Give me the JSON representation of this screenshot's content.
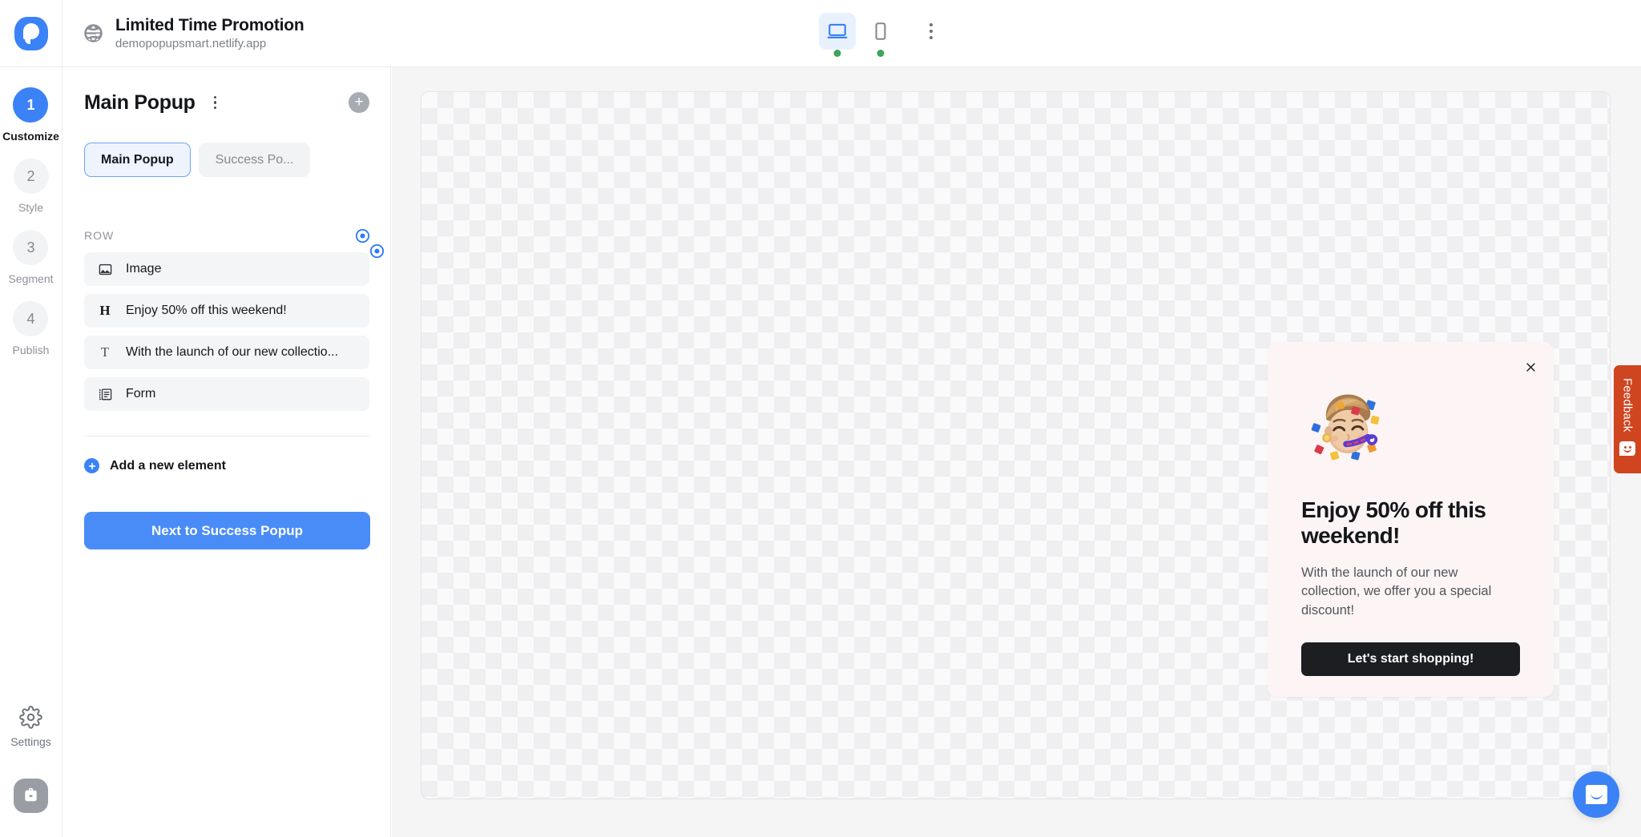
{
  "header": {
    "logo_icon": "popupsmart-logo",
    "site_icon": "globe-icon",
    "site_title": "Limited Time Promotion",
    "site_url": "demopopupsmart.netlify.app",
    "devices": [
      {
        "name": "desktop",
        "icon": "desktop-icon",
        "active": true,
        "status_dot": true
      },
      {
        "name": "mobile",
        "icon": "mobile-icon",
        "active": false,
        "status_dot": true
      }
    ],
    "more_icon": "kebab-menu-icon"
  },
  "rail": {
    "steps": [
      {
        "number": "1",
        "label": "Customize",
        "active": true
      },
      {
        "number": "2",
        "label": "Style",
        "active": false
      },
      {
        "number": "3",
        "label": "Segment",
        "active": false
      },
      {
        "number": "4",
        "label": "Publish",
        "active": false
      }
    ],
    "settings_label": "Settings",
    "settings_icon": "gear-icon",
    "toolbox_icon": "briefcase-icon"
  },
  "panel": {
    "title": "Main Popup",
    "more_icon": "kebab-menu-icon",
    "add_icon": "plus-circle-icon",
    "tabs": [
      {
        "label": "Main Popup",
        "active": true
      },
      {
        "label": "Success Po...",
        "active": false
      }
    ],
    "row_label": "ROW",
    "row_selector_icon": "radio-selected-icon",
    "elements": [
      {
        "icon": "image-icon",
        "glyph": "",
        "label": "Image",
        "selected": true
      },
      {
        "icon": "heading-icon",
        "glyph": "H",
        "label": "Enjoy 50% off this weekend!",
        "selected": false
      },
      {
        "icon": "text-icon",
        "glyph": "T",
        "label": "With the launch of our new collectio...",
        "selected": false
      },
      {
        "icon": "form-icon",
        "glyph": "",
        "label": "Form",
        "selected": false
      }
    ],
    "add_element_label": "Add a new element",
    "add_element_icon": "plus-circle-icon",
    "next_button_label": "Next to Success Popup"
  },
  "popup": {
    "close_icon": "close-icon",
    "image_icon": "party-face-emoji",
    "heading": "Enjoy 50% off this weekend!",
    "paragraph": "With the launch of our new collection, we offer you a special discount!",
    "cta_label": "Let's start shopping!",
    "background_color": "#fdf5f5",
    "cta_background_color": "#1c1e22"
  },
  "feedback": {
    "label": "Feedback",
    "icon": "feedback-smiley-icon",
    "color": "#cf4520"
  },
  "chat": {
    "icon": "intercom-chat-icon",
    "color": "#3b82f6"
  },
  "colors": {
    "accent": "#3b82f6",
    "active_step": "#3b82f6",
    "status_dot": "#3ea55a"
  }
}
